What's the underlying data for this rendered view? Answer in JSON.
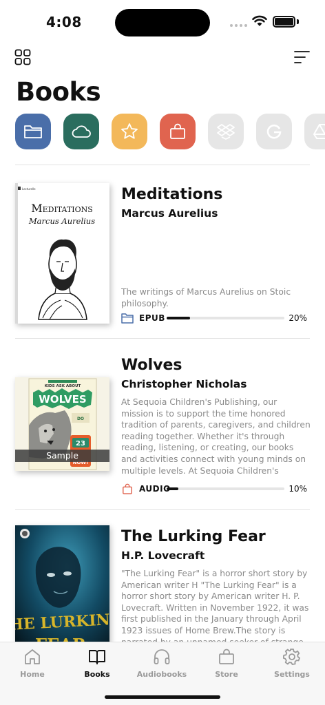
{
  "status": {
    "time": "4:08"
  },
  "page": {
    "title": "Books"
  },
  "sources": [
    {
      "name": "folder",
      "color": "#4a6ea9"
    },
    {
      "name": "cloud",
      "color": "#2a6d5e"
    },
    {
      "name": "favorites",
      "color": "#f3b85a"
    },
    {
      "name": "store",
      "color": "#e0644f"
    },
    {
      "name": "dropbox",
      "color": "#e6e6e6"
    },
    {
      "name": "google",
      "color": "#e6e6e6"
    },
    {
      "name": "google-drive",
      "color": "#e6e6e6"
    }
  ],
  "books": [
    {
      "title": "Meditations",
      "author": "Marcus Aurelius",
      "description": "The writings of Marcus Aurelius on Stoic philosophy.",
      "format": "EPUB",
      "format_icon": "folder-icon",
      "progress_percent": 20,
      "progress_label": "20%",
      "cover": {
        "title": "Meditations",
        "author": "Marcus Aurelius",
        "publisher": "Lecturelle"
      }
    },
    {
      "title": "Wolves",
      "author": "Christopher Nicholas",
      "description": "At Sequoia Children's Publishing, our mission is to support the time honored tradition of parents, caregivers, and children reading together. Whether it's through reading, listening, or creating, our books and activities connect with young minds on multiple levels. At Sequoia Children's Publishing, our mission is to support…",
      "format": "AUDIO",
      "format_icon": "shopping-bag-icon",
      "progress_percent": 10,
      "progress_label": "10%",
      "sample_label": "Sample",
      "cover": {
        "series": "KIDS ASK ABOUT",
        "title": "WOLVES",
        "number": "23",
        "badge": "NOW!"
      }
    },
    {
      "title": "The Lurking Fear",
      "author": "H.P. Lovecraft",
      "description": "\"The Lurking Fear\" is a horror short story by American writer H \"The Lurking Fear\" is a horror short story by American writer H. P. Lovecraft. Written in November 1922, it was first published in the January through April 1923 issues of Home Brew.The story is narrated by an unnamed seeker of strange horrors who is investigating the mas",
      "cover": {
        "title": "THE LURKING FEAR"
      }
    }
  ],
  "tabs": [
    {
      "label": "Home",
      "icon": "home-icon",
      "active": false
    },
    {
      "label": "Books",
      "icon": "book-open-icon",
      "active": true
    },
    {
      "label": "Audiobooks",
      "icon": "headphones-icon",
      "active": false
    },
    {
      "label": "Store",
      "icon": "shopping-bag-icon",
      "active": false
    },
    {
      "label": "Settings",
      "icon": "gear-icon",
      "active": false
    }
  ]
}
